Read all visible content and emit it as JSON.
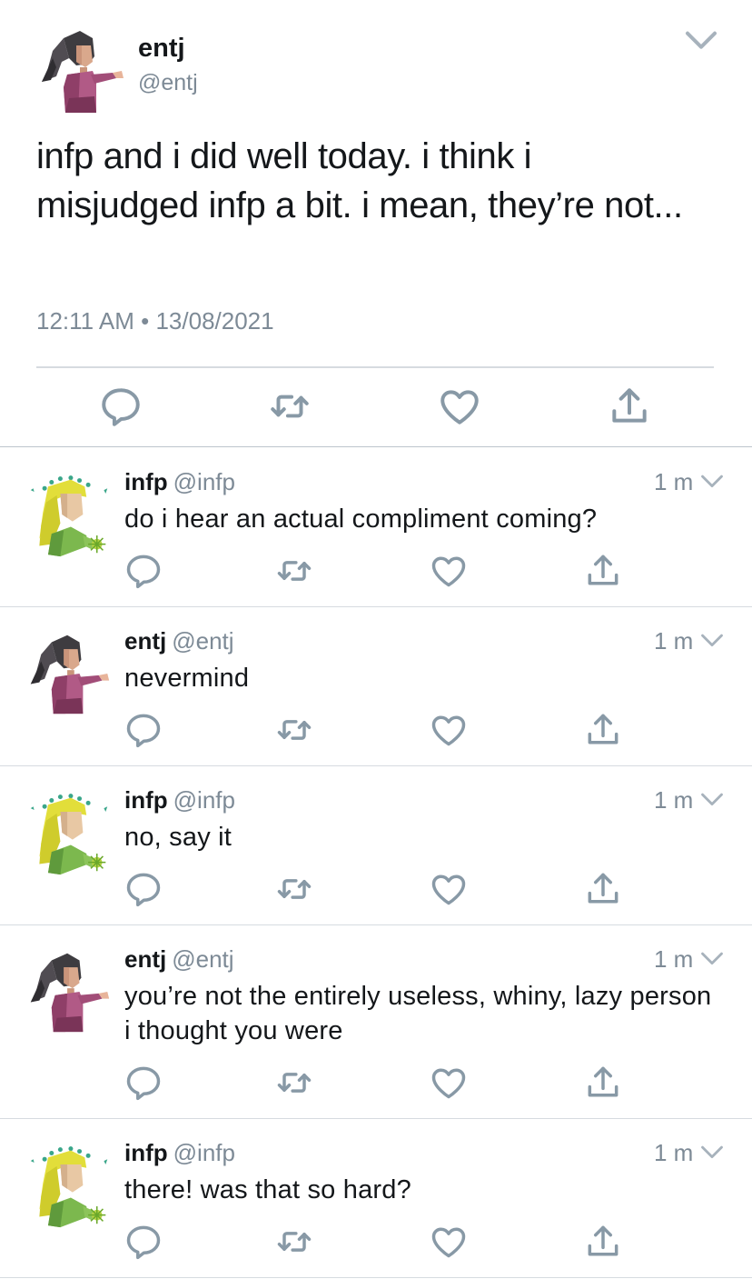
{
  "main_tweet": {
    "author_name": "entj",
    "author_handle": "@entj",
    "text": "infp and i did well today. i think i misjudged infp a bit. i mean, they’re not...",
    "timestamp": "12:11 AM • 13/08/2021",
    "avatar": "entj-avatar",
    "actions": [
      "reply-icon",
      "retweet-icon",
      "like-icon",
      "share-icon"
    ]
  },
  "replies": [
    {
      "name": "infp",
      "handle": "@infp",
      "time": "1 m",
      "text": "do i hear an actual compliment coming?",
      "avatar": "infp-avatar"
    },
    {
      "name": "entj",
      "handle": "@entj",
      "time": "1 m",
      "text": "nevermind",
      "avatar": "entj-avatar"
    },
    {
      "name": "infp",
      "handle": "@infp",
      "time": "1 m",
      "text": "no, say it",
      "avatar": "infp-avatar"
    },
    {
      "name": "entj",
      "handle": "@entj",
      "time": "1 m",
      "text": "you’re not the entirely useless, whiny, lazy person i thought you were",
      "avatar": "entj-avatar"
    },
    {
      "name": "infp",
      "handle": "@infp",
      "time": "1 m",
      "text": "there! was that so hard?",
      "avatar": "infp-avatar"
    }
  ],
  "colors": {
    "text": "#14171a",
    "secondary": "#7d8a96",
    "icon": "#8899a6",
    "divider": "#d6dbe0"
  }
}
